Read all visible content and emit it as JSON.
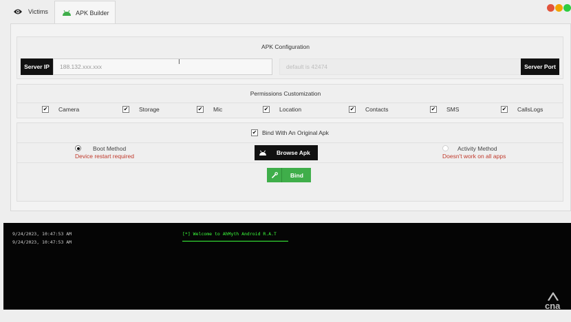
{
  "tabs": [
    {
      "label": "Victims",
      "icon": "eye-icon",
      "active": false
    },
    {
      "label": "APK Builder",
      "icon": "android-icon",
      "active": true
    }
  ],
  "window_controls": {
    "colors": [
      "#e2533b",
      "#f2a400",
      "#2ecc40"
    ]
  },
  "apk_config": {
    "title": "APK Configuration",
    "server_ip_label": "Server IP",
    "server_ip_value": "188.132.xxx.xxx",
    "server_port_placeholder": "default is 42474",
    "server_port_label": "Server Port"
  },
  "permissions": {
    "title": "Permissions Customization",
    "items": [
      {
        "label": "Camera",
        "checked": true
      },
      {
        "label": "Storage",
        "checked": true
      },
      {
        "label": "Mic",
        "checked": true
      },
      {
        "label": "Location",
        "checked": true
      },
      {
        "label": "Contacts",
        "checked": true
      },
      {
        "label": "SMS",
        "checked": true
      },
      {
        "label": "CallsLogs",
        "checked": true
      }
    ]
  },
  "bind": {
    "checkbox_label": "Bind With An Original Apk",
    "boot_method": {
      "label": "Boot Method",
      "note": "Device restart required",
      "selected": true
    },
    "browse_label": "Browse Apk",
    "activity_method": {
      "label": "Activity Method",
      "note": "Doesn't work on all apps",
      "selected": false
    },
    "bind_label": "Bind"
  },
  "console": {
    "timestamps": [
      "9/24/2023, 10:47:53 AM",
      "9/24/2023, 10:47:53 AM"
    ],
    "welcome": "[*] Welcome to AhMyth Android R.A.T"
  },
  "watermark": {
    "text": "cna"
  },
  "colors": {
    "accent_green": "#3fae4a",
    "note_red": "#c0392b",
    "console_green": "#3cff3c"
  }
}
